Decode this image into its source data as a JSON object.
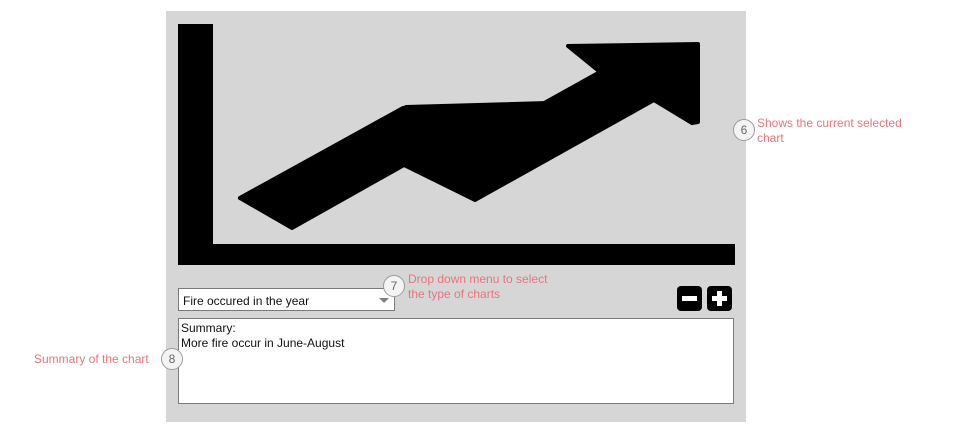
{
  "chart_selector": {
    "selected": "Fire occured in the year"
  },
  "chart_view": {
    "icon": "trending-up-chart-icon"
  },
  "zoom": {
    "zoom_out_icon": "minus-icon",
    "zoom_in_icon": "plus-icon"
  },
  "summary": {
    "line1": "Summary:",
    "line2": "More fire occur in June-August"
  },
  "annotations": [
    {
      "number": "6",
      "line1": "Shows the current selected",
      "line2": "chart"
    },
    {
      "number": "7",
      "line1": "Drop down menu to select",
      "line2": "the type of charts"
    },
    {
      "number": "8",
      "text": "Summary of the chart"
    }
  ],
  "colors": {
    "panel_background": "#d6d6d6",
    "annotation_text": "#e8747f",
    "icon": "#000000"
  }
}
